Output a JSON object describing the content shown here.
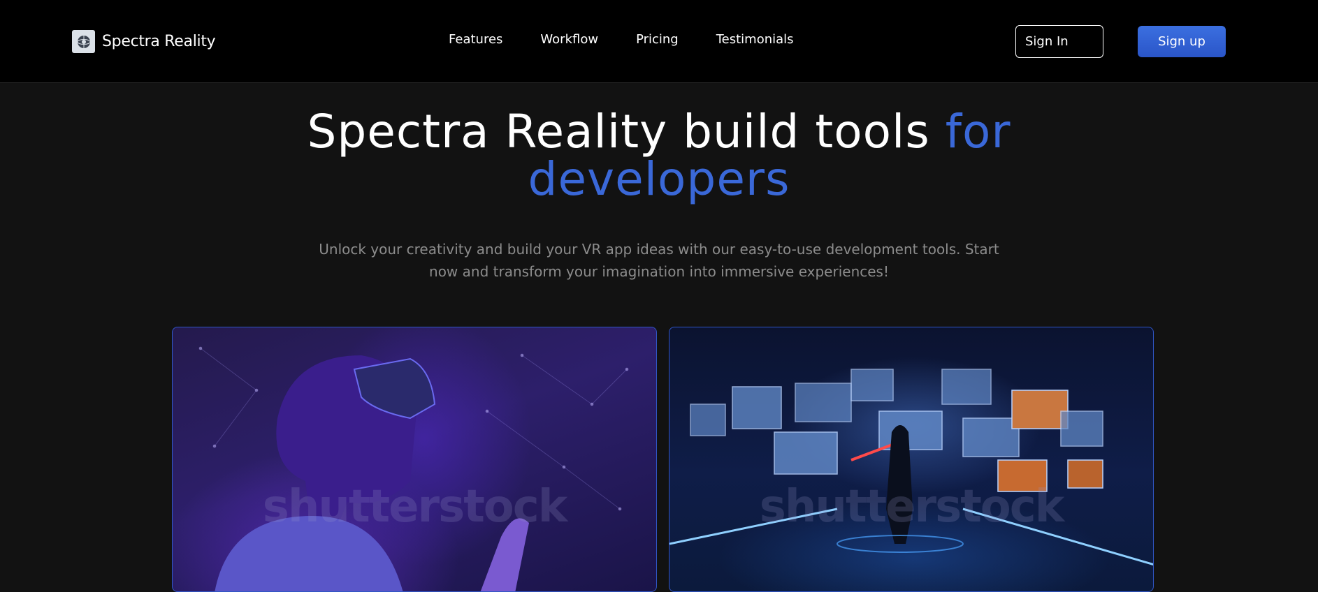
{
  "brand": {
    "name": "Spectra Reality",
    "logo_icon": "globe-logo-icon"
  },
  "nav": {
    "links": [
      "Features",
      "Workflow",
      "Pricing",
      "Testimonials"
    ]
  },
  "auth": {
    "signin_label": "Sign In",
    "signup_label": "Sign up"
  },
  "hero": {
    "title_part1": "Spectra Reality build tools ",
    "title_accent_inline": "for",
    "title_accent_line2": "developers",
    "subtitle_line1": "Unlock your creativity and build your VR app ideas with our easy-to-use development tools. Start",
    "subtitle_line2": "now and transform your imagination into immersive experiences!"
  },
  "gallery": {
    "watermark": "shutterstock"
  },
  "colors": {
    "background": "#121212",
    "navbar": "#000000",
    "accent": "#3a68d8",
    "card_border": "#3056c6"
  }
}
